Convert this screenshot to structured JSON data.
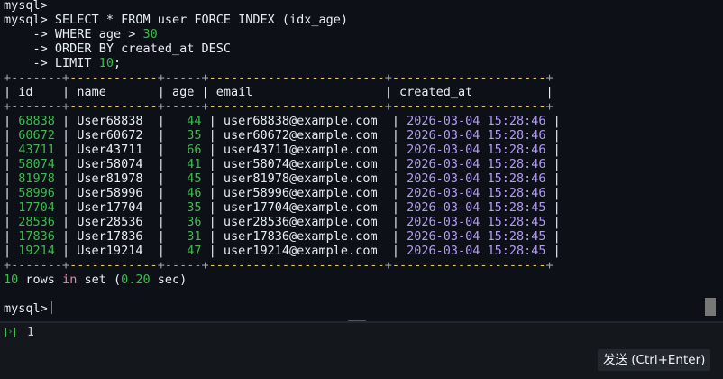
{
  "terminal": {
    "prompt": "mysql>",
    "continuation": "->",
    "query": {
      "line1": "SELECT * FROM user FORCE INDEX (idx_age)",
      "line2_kw": "WHERE age >",
      "line2_val": "30",
      "line3": "ORDER BY created_at DESC",
      "line4_kw": "LIMIT",
      "line4_val": "10",
      "line4_end": ";"
    },
    "table": {
      "border": "+-------+------------+-----+------------------------+---------------------+",
      "headers": [
        "id",
        "name",
        "age",
        "email",
        "created_at"
      ],
      "rows": [
        [
          "68838",
          "User68838",
          "44",
          "user68838@example.com",
          "2026-03-04 15:28:46"
        ],
        [
          "60672",
          "User60672",
          "35",
          "user60672@example.com",
          "2026-03-04 15:28:46"
        ],
        [
          "43711",
          "User43711",
          "66",
          "user43711@example.com",
          "2026-03-04 15:28:46"
        ],
        [
          "58074",
          "User58074",
          "41",
          "user58074@example.com",
          "2026-03-04 15:28:46"
        ],
        [
          "81978",
          "User81978",
          "45",
          "user81978@example.com",
          "2026-03-04 15:28:46"
        ],
        [
          "58996",
          "User58996",
          "46",
          "user58996@example.com",
          "2026-03-04 15:28:46"
        ],
        [
          "17704",
          "User17704",
          "35",
          "user17704@example.com",
          "2026-03-04 15:28:45"
        ],
        [
          "28536",
          "User28536",
          "36",
          "user28536@example.com",
          "2026-03-04 15:28:45"
        ],
        [
          "17836",
          "User17836",
          "31",
          "user17836@example.com",
          "2026-03-04 15:28:45"
        ],
        [
          "19214",
          "User19214",
          "47",
          "user19214@example.com",
          "2026-03-04 15:28:45"
        ]
      ]
    },
    "result": {
      "count": "10",
      "rows_word": "rows",
      "in_word": "in",
      "set_word": "set",
      "time": "0.20",
      "unit": "sec"
    }
  },
  "input": {
    "line_number": "1"
  },
  "send_button": {
    "label": "发送 (Ctrl+Enter)"
  },
  "colors": {
    "number": "#3fb950",
    "date": "#b29cf2",
    "keyword": "#ff7b9c",
    "border_accent": "#e3c65a",
    "background": "#0d1117"
  }
}
